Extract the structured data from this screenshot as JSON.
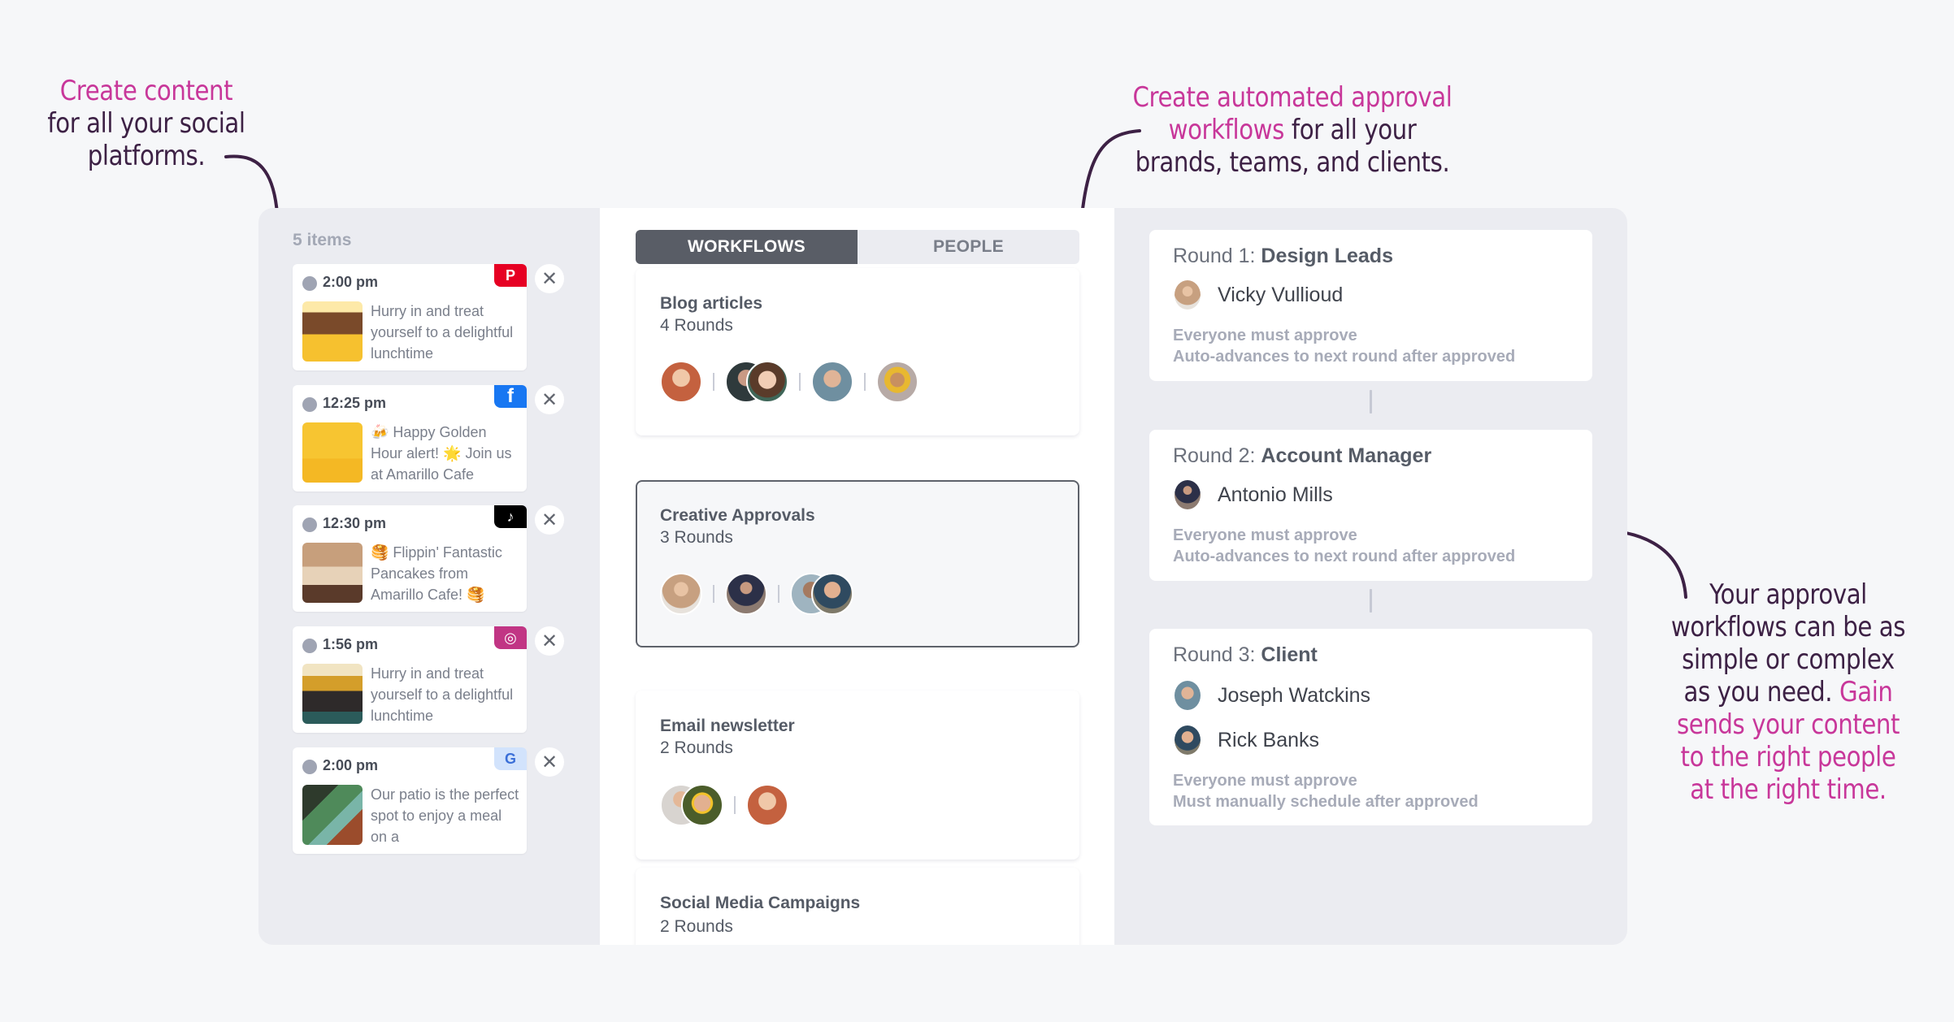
{
  "annotations": {
    "left": {
      "highlight": "Create content",
      "rest": "for all your social platforms."
    },
    "top": {
      "highlight": "Create automated approval workflows",
      "rest": "for all your brands, teams, and clients."
    },
    "right": {
      "plain": "Your approval workflows can be as simple or complex as you need.",
      "highlight": "Gain sends your content to the right people at the right time."
    }
  },
  "queue": {
    "count_label": "5 items",
    "posts": [
      {
        "time": "2:00 pm",
        "text": "Hurry in and treat yourself to a delightful lunchtime",
        "platform": "pinterest",
        "platform_icon": "pinterest-icon",
        "platform_color": "#e60023",
        "thumb": "todays-promo-image"
      },
      {
        "time": "12:25 pm",
        "text": "🍻 Happy Golden Hour alert! 🌟 Join us at Amarillo Cafe",
        "platform": "facebook",
        "platform_icon": "facebook-icon",
        "platform_color": "#1877f2",
        "thumb": "golden-hour-image"
      },
      {
        "time": "12:30 pm",
        "text": "🥞 Flippin' Fantastic Pancakes from Amarillo Cafe! 🥞",
        "platform": "tiktok",
        "platform_icon": "tiktok-icon",
        "platform_color": "#000000",
        "thumb": "pancakes-image"
      },
      {
        "time": "1:56 pm",
        "text": "Hurry in and treat yourself to a delightful lunchtime",
        "platform": "instagram",
        "platform_icon": "instagram-icon",
        "platform_color": "#c13584",
        "thumb": "free-delivery-image"
      },
      {
        "time": "2:00 pm",
        "text": "Our patio is the perfect spot to enjoy a meal on a",
        "platform": "google-business",
        "platform_icon": "google-business-icon",
        "platform_color": "#d2e3fc",
        "thumb": "patio-image"
      }
    ],
    "close_glyph": "✕"
  },
  "workflows": {
    "tabs": [
      {
        "label": "WORKFLOWS",
        "active": true
      },
      {
        "label": "PEOPLE",
        "active": false
      }
    ],
    "items": [
      {
        "name": "Blog articles",
        "rounds": "4 Rounds",
        "selected": false
      },
      {
        "name": "Creative Approvals",
        "rounds": "3 Rounds",
        "selected": true
      },
      {
        "name": "Email newsletter",
        "rounds": "2 Rounds",
        "selected": false
      },
      {
        "name": "Social Media Campaigns",
        "rounds": "2 Rounds",
        "selected": false
      }
    ]
  },
  "rounds": [
    {
      "prefix": "Round 1:",
      "name": "Design Leads",
      "members": [
        "Vicky Vullioud"
      ],
      "rule": "Everyone must approve",
      "after": "Auto-advances to next round after approved"
    },
    {
      "prefix": "Round 2:",
      "name": "Account Manager",
      "members": [
        "Antonio Mills"
      ],
      "rule": "Everyone must approve",
      "after": "Auto-advances to next round after approved"
    },
    {
      "prefix": "Round 3:",
      "name": "Client",
      "members": [
        "Joseph Watckins",
        "Rick Banks"
      ],
      "rule": "Everyone must approve",
      "after": "Must manually schedule after approved"
    }
  ],
  "colors": {
    "accent_pink": "#c8379a",
    "annotation_ink": "#3d2145",
    "active_tab": "#595d66"
  }
}
